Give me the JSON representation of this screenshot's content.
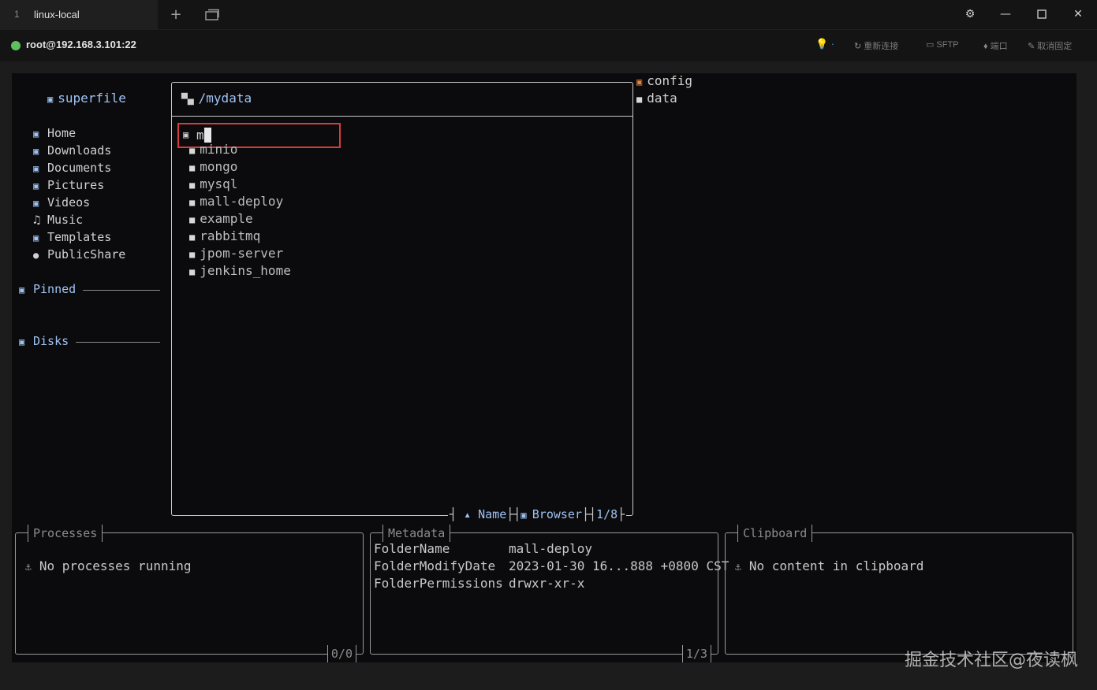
{
  "window": {
    "tab_number": "1",
    "tab_title": "linux-local",
    "new_tab_icon": "plus-icon",
    "tab_overview_icon": "window-stack-icon",
    "settings_icon": "gear-icon",
    "minimize_icon": "minimize-icon",
    "maximize_icon": "maximize-icon",
    "close_icon": "close-icon"
  },
  "connection": {
    "status_color": "#5ec05e",
    "label": "root@192.168.3.101:22",
    "actions": {
      "hint": "💡 ·",
      "reconnect": "重新连接",
      "sftp": "SFTP",
      "port": "端口",
      "unpin": "取消固定"
    }
  },
  "sidebar": {
    "title": "superfile",
    "items": [
      {
        "label": "Home",
        "icon": "home-icon"
      },
      {
        "label": "Downloads",
        "icon": "download-icon"
      },
      {
        "label": "Documents",
        "icon": "document-icon"
      },
      {
        "label": "Pictures",
        "icon": "picture-icon"
      },
      {
        "label": "Videos",
        "icon": "video-icon"
      },
      {
        "label": "Music",
        "icon": "music-icon"
      },
      {
        "label": "Templates",
        "icon": "template-icon"
      },
      {
        "label": "PublicShare",
        "icon": "globe-icon"
      }
    ],
    "pinned_label": "Pinned",
    "disks_label": "Disks"
  },
  "file_panel": {
    "path": "/mydata",
    "search_value": "m",
    "items": [
      "minio",
      "mongo",
      "mysql",
      "mall-deploy",
      "example",
      "rabbitmq",
      "jpom-server",
      "jenkins_home"
    ],
    "sort_indicator": "▴",
    "sort_label": "Name",
    "mode_label": "Browser",
    "position": "1/8"
  },
  "preview": {
    "items": [
      {
        "label": "config",
        "icon": "config-folder-icon",
        "color": "#e8833a"
      },
      {
        "label": "data",
        "icon": "folder-icon",
        "color": "#d8d8d8"
      }
    ]
  },
  "processes": {
    "title": "Processes",
    "message": "No processes running",
    "count": "0/0"
  },
  "metadata": {
    "title": "Metadata",
    "rows": [
      {
        "key": "FolderName",
        "value": "mall-deploy"
      },
      {
        "key": "FolderModifyDate",
        "value": "2023-01-30 16...888 +0800 CST"
      },
      {
        "key": "FolderPermissions",
        "value": "drwxr-xr-x"
      }
    ],
    "count": "1/3"
  },
  "clipboard": {
    "title": "Clipboard",
    "message": "No content in clipboard"
  },
  "watermark": "掘金技术社区@夜读枫"
}
